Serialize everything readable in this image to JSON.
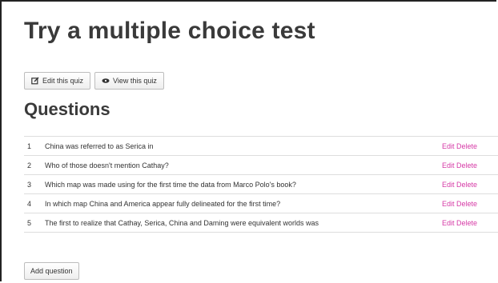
{
  "page": {
    "title": "Try a multiple choice test",
    "questions_heading": "Questions"
  },
  "toolbar": {
    "edit_label": "Edit this quiz",
    "edit_icon": "edit-icon",
    "view_label": "View this quiz",
    "view_icon": "eye-icon"
  },
  "questions": [
    {
      "number": "1",
      "text": "China was referred to as Serica in",
      "edit": "Edit",
      "delete": "Delete"
    },
    {
      "number": "2",
      "text": "Who of those doesn't mention Cathay?",
      "edit": "Edit",
      "delete": "Delete"
    },
    {
      "number": "3",
      "text": "Which map was made using for the first time the data from Marco Polo's book?",
      "edit": "Edit",
      "delete": "Delete"
    },
    {
      "number": "4",
      "text": "In which map China and America appear fully delineated for the first time?",
      "edit": "Edit",
      "delete": "Delete"
    },
    {
      "number": "5",
      "text": "The first to realize that Cathay, Serica, China and Daming were equivalent worlds was",
      "edit": "Edit",
      "delete": "Delete"
    }
  ],
  "footer": {
    "add_label": "Add question"
  },
  "colors": {
    "link": "#d63aa6",
    "text": "#333333",
    "heading": "#3a3a3a"
  }
}
